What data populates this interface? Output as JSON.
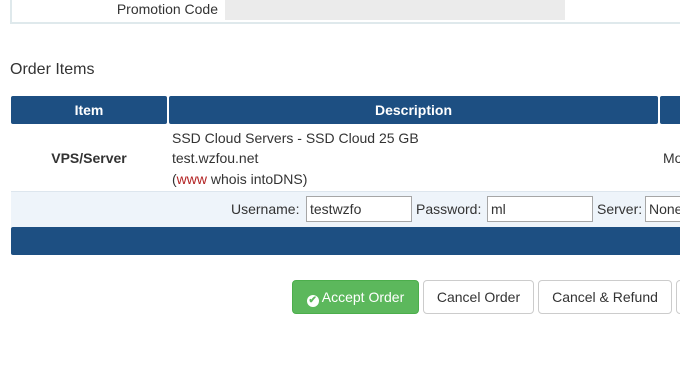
{
  "promotion": {
    "label": "Promotion Code"
  },
  "order_items": {
    "title": "Order Items",
    "columns": [
      "Item",
      "Description"
    ],
    "rows": [
      {
        "item": "VPS/Server",
        "description": {
          "product": "SSD Cloud Servers - SSD Cloud 25 GB",
          "domain": "test.wzfou.net",
          "paren_open": "(",
          "www_link": "www",
          "whois_link": "whois",
          "intodns_link": "intoDNS",
          "paren_close": ")"
        },
        "extra": "Mo"
      }
    ],
    "credentials": {
      "username_label": "Username:",
      "username_value": "testwzfo",
      "password_label": "Password:",
      "password_value": "ml",
      "server_label": "Server:",
      "server_value": "None"
    }
  },
  "actions": {
    "accept": "Accept Order",
    "cancel": "Cancel Order",
    "cancel_refund": "Cancel & Refund"
  },
  "colors": {
    "header_bg": "#1d4f82",
    "accept_bg": "#5cb85c",
    "link_red": "#b22222"
  }
}
